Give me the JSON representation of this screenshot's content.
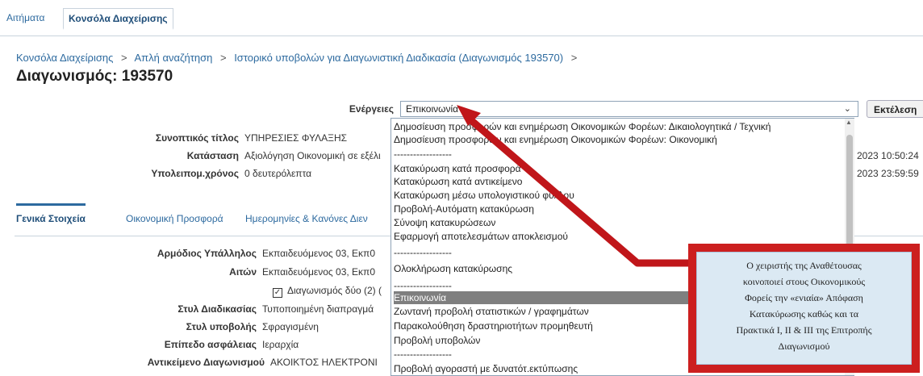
{
  "tabs": [
    "Αιτήματα",
    "Κονσόλα Διαχείρισης"
  ],
  "breadcrumb": [
    "Κονσόλα Διαχείρισης",
    "Απλή αναζήτηση",
    "Ιστορικό υποβολών για Διαγωνιστική Διαδικασία (Διαγωνισμός 193570)"
  ],
  "breadcrumb_sep": ">",
  "page_title": "Διαγωνισμός: 193570",
  "actions": {
    "label": "Ενέργειες",
    "selected": "Επικοινωνία",
    "execute_label": "Εκτέλεση",
    "options": [
      "Δημοσίευση προσφορών και ενημέρωση Οικονομικών Φορέων: Δικαιολογητικά / Τεχνική",
      "Δημοσίευση προσφορών και ενημέρωση Οικονομικών Φορέων: Οικονομική",
      "------------------",
      "Κατακύρωση κατά προσφορά",
      "Κατακύρωση κατά αντικείμενο",
      "Κατακύρωση μέσω υπολογιστικού φύλλου",
      "Προβολή-Αυτόματη κατακύρωση",
      "Σύνοψη κατακυρώσεων",
      "Εφαρμογή αποτελεσμάτων αποκλεισμού",
      "------------------",
      "Ολοκλήρωση κατακύρωσης",
      "------------------",
      "Επικοινωνία",
      "Ζωντανή προβολή στατιστικών / γραφημάτων",
      "Παρακολούθηση δραστηριοτήτων προμηθευτή",
      "Προβολή υποβολών",
      "------------------",
      "Προβολή αγοραστή με δυνατότ.εκτύπωσης"
    ]
  },
  "summary": {
    "title_label": "Συνοπτικός τίτλος",
    "title_value": "ΥΠΗΡΕΣΙΕΣ ΦΥΛΑΞΗΣ",
    "status_label": "Κατάσταση",
    "status_value": "Αξιολόγηση Οικονομική σε εξέλι",
    "remaining_label": "Υπολειπομ.χρόνος",
    "remaining_value": "0 δευτερόλεπτα",
    "date1": "2023 10:50:24",
    "date2": "2023 23:59:59"
  },
  "subtabs": [
    "Γενικά Στοιχεία",
    "Οικονομική Προσφορά",
    "Ημερομηνίες & Κανόνες Διεν"
  ],
  "details": [
    {
      "label": "Αρμόδιος Υπάλληλος",
      "value": "Εκπαιδευόμενος 03, Εκπ0"
    },
    {
      "label": "Αιτών",
      "value": "Εκπαιδευόμενος 03, Εκπ0"
    },
    {
      "label": "",
      "value": "Διαγωνισμός δύο (2) ("
    },
    {
      "label": "Στυλ Διαδικασίας",
      "value": "Τυποποιημένη διαπραγμά"
    },
    {
      "label": "Στυλ υποβολής",
      "value": "Σφραγισμένη"
    },
    {
      "label": "Επίπεδο ασφάλειας",
      "value": "Ιεραρχία"
    },
    {
      "label": "Αντικείμενο Διαγωνισμού",
      "value": "ΑΚΟΙΚΤΟΣ ΗΛΕΚΤΡΟΝΙ"
    }
  ],
  "callout_lines": [
    "Ο χειριστής της Αναθέτουσας",
    "κοινοποιεί στους Οικονομικούς",
    "Φορείς την «ενιαία» Απόφαση",
    "Κατακύρωσης καθώς και τα",
    "Πρακτικά Ι, ΙΙ & ΙΙΙ της Επιτροπής",
    "Διαγωνισμού"
  ],
  "colors": {
    "arrow": "#c0161a",
    "callout_bg": "#dbe9f3",
    "link": "#2d6a9f",
    "selected_option": "#7f7f7f"
  }
}
